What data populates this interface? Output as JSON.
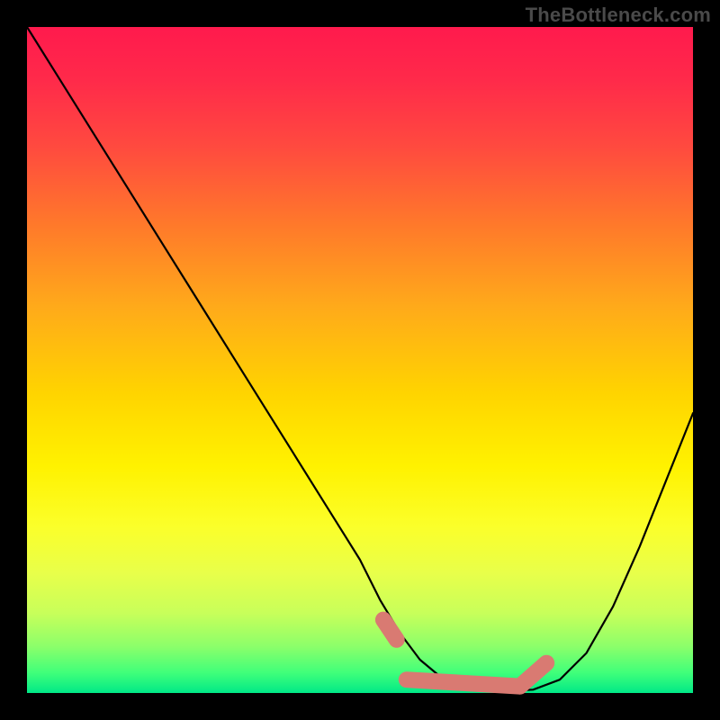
{
  "attribution": "TheBottleneck.com",
  "chart_data": {
    "type": "line",
    "title": "",
    "xlabel": "",
    "ylabel": "",
    "xlim": [
      0,
      100
    ],
    "ylim": [
      0,
      100
    ],
    "series": [
      {
        "name": "bottleneck-curve",
        "x": [
          0,
          5,
          10,
          15,
          20,
          25,
          30,
          35,
          40,
          45,
          50,
          53,
          56,
          59,
          62,
          65,
          68,
          72,
          76,
          80,
          84,
          88,
          92,
          96,
          100
        ],
        "values": [
          100,
          92,
          84,
          76,
          68,
          60,
          52,
          44,
          36,
          28,
          20,
          14,
          9,
          5,
          2.5,
          1,
          0.5,
          0.3,
          0.5,
          2,
          6,
          13,
          22,
          32,
          42
        ]
      }
    ],
    "overlay": {
      "name": "highlight-band",
      "color": "#d97a72",
      "segments": [
        {
          "x": [
            53.5,
            55.5
          ],
          "values": [
            11.0,
            8.0
          ]
        },
        {
          "x": [
            57,
            74
          ],
          "values": [
            2.0,
            1.0
          ]
        },
        {
          "x": [
            74,
            78
          ],
          "values": [
            1.0,
            4.5
          ]
        }
      ]
    },
    "gradient_stops": [
      {
        "pos": 0,
        "color": "#ff1a4d"
      },
      {
        "pos": 50,
        "color": "#ffe000"
      },
      {
        "pos": 100,
        "color": "#00e887"
      }
    ]
  }
}
